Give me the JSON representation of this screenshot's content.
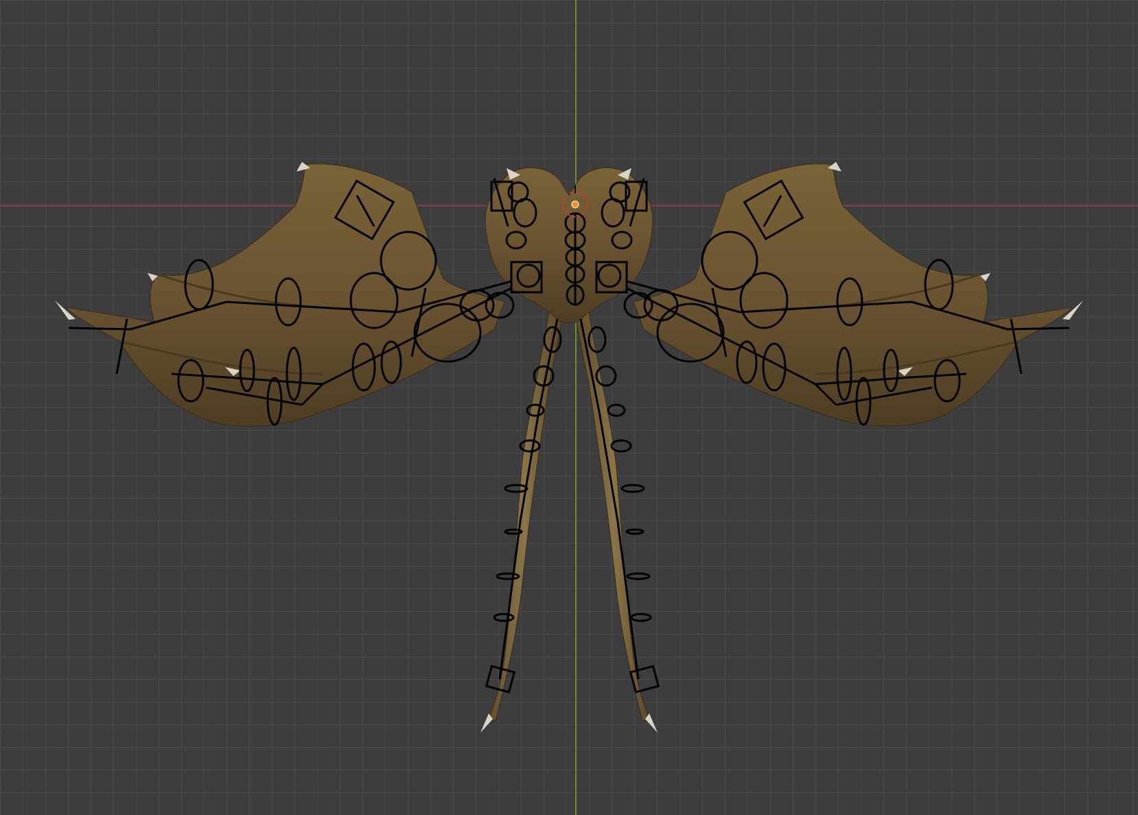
{
  "viewport": {
    "background_color": "#3d3d3d",
    "grid_color": "#4a4a4a",
    "x_axis_color": "#8d3b47",
    "y_axis_color": "#6f8f2d"
  },
  "object": {
    "type": "armature over mesh",
    "mesh_color": "#6b5530",
    "bone_color": "#000000",
    "origin_marker_color": "#ff8a1c"
  },
  "icons": {
    "origin": "origin-dot-icon",
    "cursor": "3d-cursor-icon"
  }
}
